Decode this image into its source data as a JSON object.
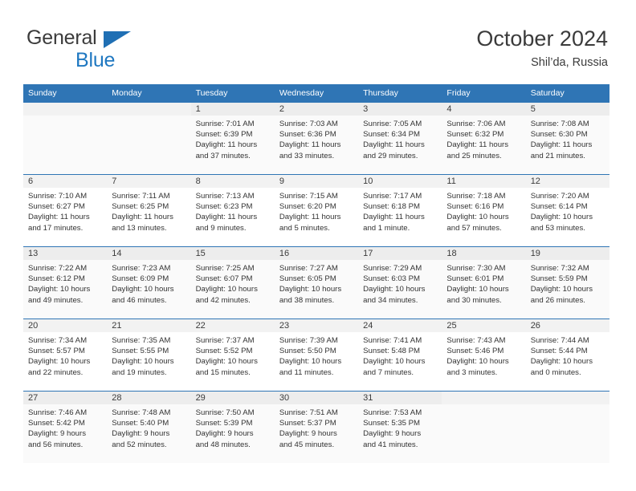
{
  "brand": {
    "word1": "General",
    "word2": "Blue",
    "triangle_color": "#1f6fb4",
    "blue_color": "#1f78c1"
  },
  "header": {
    "title": "October 2024",
    "subtitle": "Shil’da, Russia"
  },
  "calendar": {
    "header_bg": "#2f75b5",
    "daynum_bg": "#f2f2f2",
    "weekday_headers": [
      "Sunday",
      "Monday",
      "Tuesday",
      "Wednesday",
      "Thursday",
      "Friday",
      "Saturday"
    ],
    "weeks": [
      [
        {
          "day": "",
          "lines": []
        },
        {
          "day": "",
          "lines": []
        },
        {
          "day": "1",
          "lines": [
            "Sunrise: 7:01 AM",
            "Sunset: 6:39 PM",
            "Daylight: 11 hours",
            "and 37 minutes."
          ]
        },
        {
          "day": "2",
          "lines": [
            "Sunrise: 7:03 AM",
            "Sunset: 6:36 PM",
            "Daylight: 11 hours",
            "and 33 minutes."
          ]
        },
        {
          "day": "3",
          "lines": [
            "Sunrise: 7:05 AM",
            "Sunset: 6:34 PM",
            "Daylight: 11 hours",
            "and 29 minutes."
          ]
        },
        {
          "day": "4",
          "lines": [
            "Sunrise: 7:06 AM",
            "Sunset: 6:32 PM",
            "Daylight: 11 hours",
            "and 25 minutes."
          ]
        },
        {
          "day": "5",
          "lines": [
            "Sunrise: 7:08 AM",
            "Sunset: 6:30 PM",
            "Daylight: 11 hours",
            "and 21 minutes."
          ]
        }
      ],
      [
        {
          "day": "6",
          "lines": [
            "Sunrise: 7:10 AM",
            "Sunset: 6:27 PM",
            "Daylight: 11 hours",
            "and 17 minutes."
          ]
        },
        {
          "day": "7",
          "lines": [
            "Sunrise: 7:11 AM",
            "Sunset: 6:25 PM",
            "Daylight: 11 hours",
            "and 13 minutes."
          ]
        },
        {
          "day": "8",
          "lines": [
            "Sunrise: 7:13 AM",
            "Sunset: 6:23 PM",
            "Daylight: 11 hours",
            "and 9 minutes."
          ]
        },
        {
          "day": "9",
          "lines": [
            "Sunrise: 7:15 AM",
            "Sunset: 6:20 PM",
            "Daylight: 11 hours",
            "and 5 minutes."
          ]
        },
        {
          "day": "10",
          "lines": [
            "Sunrise: 7:17 AM",
            "Sunset: 6:18 PM",
            "Daylight: 11 hours",
            "and 1 minute."
          ]
        },
        {
          "day": "11",
          "lines": [
            "Sunrise: 7:18 AM",
            "Sunset: 6:16 PM",
            "Daylight: 10 hours",
            "and 57 minutes."
          ]
        },
        {
          "day": "12",
          "lines": [
            "Sunrise: 7:20 AM",
            "Sunset: 6:14 PM",
            "Daylight: 10 hours",
            "and 53 minutes."
          ]
        }
      ],
      [
        {
          "day": "13",
          "lines": [
            "Sunrise: 7:22 AM",
            "Sunset: 6:12 PM",
            "Daylight: 10 hours",
            "and 49 minutes."
          ]
        },
        {
          "day": "14",
          "lines": [
            "Sunrise: 7:23 AM",
            "Sunset: 6:09 PM",
            "Daylight: 10 hours",
            "and 46 minutes."
          ]
        },
        {
          "day": "15",
          "lines": [
            "Sunrise: 7:25 AM",
            "Sunset: 6:07 PM",
            "Daylight: 10 hours",
            "and 42 minutes."
          ]
        },
        {
          "day": "16",
          "lines": [
            "Sunrise: 7:27 AM",
            "Sunset: 6:05 PM",
            "Daylight: 10 hours",
            "and 38 minutes."
          ]
        },
        {
          "day": "17",
          "lines": [
            "Sunrise: 7:29 AM",
            "Sunset: 6:03 PM",
            "Daylight: 10 hours",
            "and 34 minutes."
          ]
        },
        {
          "day": "18",
          "lines": [
            "Sunrise: 7:30 AM",
            "Sunset: 6:01 PM",
            "Daylight: 10 hours",
            "and 30 minutes."
          ]
        },
        {
          "day": "19",
          "lines": [
            "Sunrise: 7:32 AM",
            "Sunset: 5:59 PM",
            "Daylight: 10 hours",
            "and 26 minutes."
          ]
        }
      ],
      [
        {
          "day": "20",
          "lines": [
            "Sunrise: 7:34 AM",
            "Sunset: 5:57 PM",
            "Daylight: 10 hours",
            "and 22 minutes."
          ]
        },
        {
          "day": "21",
          "lines": [
            "Sunrise: 7:35 AM",
            "Sunset: 5:55 PM",
            "Daylight: 10 hours",
            "and 19 minutes."
          ]
        },
        {
          "day": "22",
          "lines": [
            "Sunrise: 7:37 AM",
            "Sunset: 5:52 PM",
            "Daylight: 10 hours",
            "and 15 minutes."
          ]
        },
        {
          "day": "23",
          "lines": [
            "Sunrise: 7:39 AM",
            "Sunset: 5:50 PM",
            "Daylight: 10 hours",
            "and 11 minutes."
          ]
        },
        {
          "day": "24",
          "lines": [
            "Sunrise: 7:41 AM",
            "Sunset: 5:48 PM",
            "Daylight: 10 hours",
            "and 7 minutes."
          ]
        },
        {
          "day": "25",
          "lines": [
            "Sunrise: 7:43 AM",
            "Sunset: 5:46 PM",
            "Daylight: 10 hours",
            "and 3 minutes."
          ]
        },
        {
          "day": "26",
          "lines": [
            "Sunrise: 7:44 AM",
            "Sunset: 5:44 PM",
            "Daylight: 10 hours",
            "and 0 minutes."
          ]
        }
      ],
      [
        {
          "day": "27",
          "lines": [
            "Sunrise: 7:46 AM",
            "Sunset: 5:42 PM",
            "Daylight: 9 hours",
            "and 56 minutes."
          ]
        },
        {
          "day": "28",
          "lines": [
            "Sunrise: 7:48 AM",
            "Sunset: 5:40 PM",
            "Daylight: 9 hours",
            "and 52 minutes."
          ]
        },
        {
          "day": "29",
          "lines": [
            "Sunrise: 7:50 AM",
            "Sunset: 5:39 PM",
            "Daylight: 9 hours",
            "and 48 minutes."
          ]
        },
        {
          "day": "30",
          "lines": [
            "Sunrise: 7:51 AM",
            "Sunset: 5:37 PM",
            "Daylight: 9 hours",
            "and 45 minutes."
          ]
        },
        {
          "day": "31",
          "lines": [
            "Sunrise: 7:53 AM",
            "Sunset: 5:35 PM",
            "Daylight: 9 hours",
            "and 41 minutes."
          ]
        },
        {
          "day": "",
          "lines": []
        },
        {
          "day": "",
          "lines": []
        }
      ]
    ]
  }
}
